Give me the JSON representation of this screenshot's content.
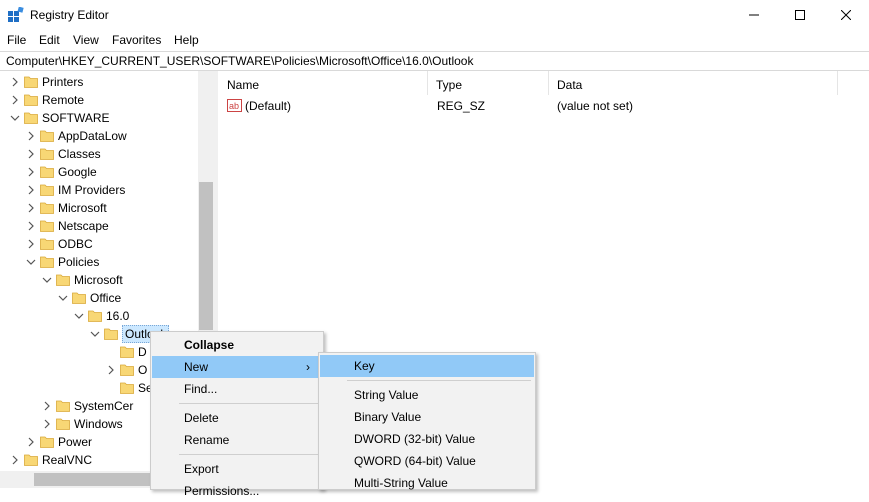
{
  "window": {
    "title": "Registry Editor"
  },
  "menu": [
    "File",
    "Edit",
    "View",
    "Favorites",
    "Help"
  ],
  "address": "Computer\\HKEY_CURRENT_USER\\SOFTWARE\\Policies\\Microsoft\\Office\\16.0\\Outlook",
  "tree": [
    {
      "label": "Printers",
      "indent": 0,
      "state": "collapsed"
    },
    {
      "label": "Remote",
      "indent": 0,
      "state": "collapsed"
    },
    {
      "label": "SOFTWARE",
      "indent": 0,
      "state": "expanded"
    },
    {
      "label": "AppDataLow",
      "indent": 1,
      "state": "collapsed"
    },
    {
      "label": "Classes",
      "indent": 1,
      "state": "collapsed"
    },
    {
      "label": "Google",
      "indent": 1,
      "state": "collapsed"
    },
    {
      "label": "IM Providers",
      "indent": 1,
      "state": "collapsed"
    },
    {
      "label": "Microsoft",
      "indent": 1,
      "state": "collapsed"
    },
    {
      "label": "Netscape",
      "indent": 1,
      "state": "collapsed"
    },
    {
      "label": "ODBC",
      "indent": 1,
      "state": "collapsed"
    },
    {
      "label": "Policies",
      "indent": 1,
      "state": "expanded"
    },
    {
      "label": "Microsoft",
      "indent": 2,
      "state": "expanded"
    },
    {
      "label": "Office",
      "indent": 3,
      "state": "expanded"
    },
    {
      "label": "16.0",
      "indent": 4,
      "state": "expanded"
    },
    {
      "label": "Outlook",
      "indent": 5,
      "state": "expanded",
      "selected": true
    },
    {
      "label": "D",
      "indent": 6,
      "state": "none"
    },
    {
      "label": "O",
      "indent": 6,
      "state": "collapsed"
    },
    {
      "label": "Se",
      "indent": 6,
      "state": "none"
    },
    {
      "label": "SystemCer",
      "indent": 2,
      "state": "collapsed"
    },
    {
      "label": "Windows",
      "indent": 2,
      "state": "collapsed"
    },
    {
      "label": "Power",
      "indent": 1,
      "state": "collapsed"
    },
    {
      "label": "RealVNC",
      "indent": 0,
      "state": "collapsed"
    }
  ],
  "columns": [
    "Name",
    "Type",
    "Data"
  ],
  "values": [
    {
      "name": "(Default)",
      "type": "REG_SZ",
      "data": "(value not set)"
    }
  ],
  "context_menu": {
    "items": [
      {
        "label": "Collapse",
        "bold": true
      },
      {
        "label": "New",
        "submenu": true,
        "highlighted": true
      },
      {
        "label": "Find..."
      },
      {
        "sep": true
      },
      {
        "label": "Delete"
      },
      {
        "label": "Rename"
      },
      {
        "sep": true
      },
      {
        "label": "Export"
      },
      {
        "label": "Permissions..."
      }
    ]
  },
  "submenu": {
    "items": [
      {
        "label": "Key",
        "highlighted": true
      },
      {
        "sep": true
      },
      {
        "label": "String Value"
      },
      {
        "label": "Binary Value"
      },
      {
        "label": "DWORD (32-bit) Value"
      },
      {
        "label": "QWORD (64-bit) Value"
      },
      {
        "label": "Multi-String Value"
      }
    ]
  },
  "colors": {
    "highlight": "#91c9f7",
    "selection": "#cce8ff",
    "folder": "#f8d775"
  }
}
